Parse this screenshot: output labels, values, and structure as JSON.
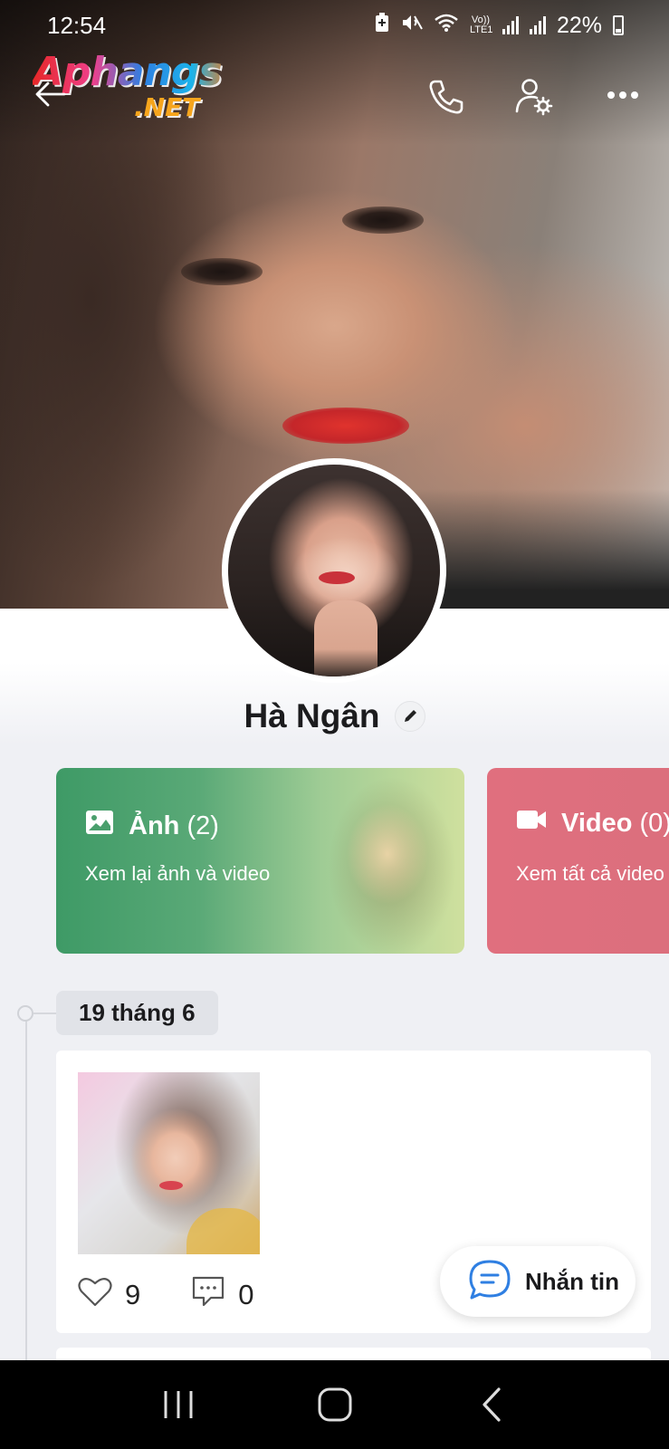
{
  "status_bar": {
    "time": "12:54",
    "network_label": "Vo)) LTE1",
    "battery": "22%"
  },
  "watermark": {
    "top": "Aphangs",
    "bottom": ".NET"
  },
  "header": {
    "back_icon": "arrow-left-icon",
    "call_icon": "phone-icon",
    "settings_icon": "user-gear-icon",
    "more_icon": "more-dots-icon"
  },
  "profile": {
    "name": "Hà Ngân",
    "edit_icon": "pencil-icon"
  },
  "media_cards": {
    "photos": {
      "title": "Ảnh",
      "count": "(2)",
      "subtitle": "Xem lại ảnh và video",
      "color": "#3e9a66"
    },
    "videos": {
      "title": "Video",
      "count": "(0)",
      "subtitle": "Xem tất cả video",
      "color": "#e06f7e"
    }
  },
  "timeline": {
    "date_label": "19 tháng 6",
    "post": {
      "likes": "9",
      "comments": "0"
    }
  },
  "message_button": {
    "label": "Nhắn tin",
    "accent": "#2f7fe2"
  }
}
